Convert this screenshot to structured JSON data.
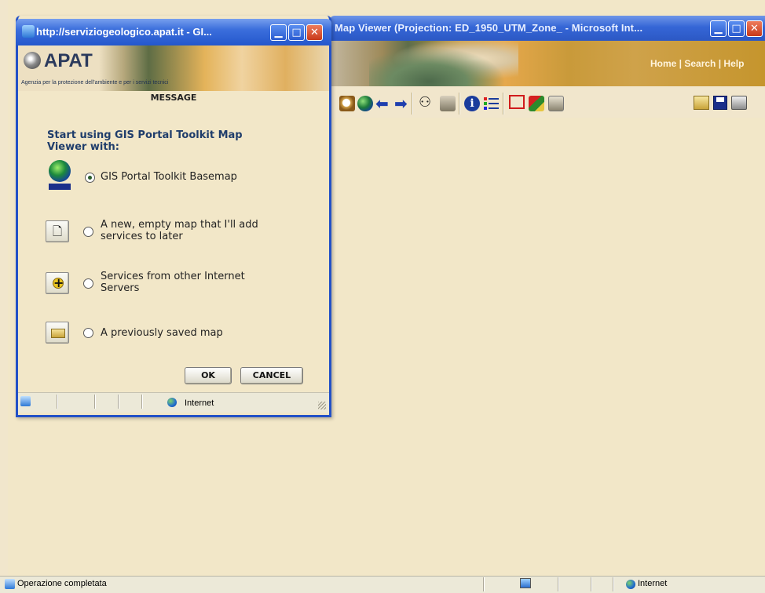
{
  "background_window": {
    "title": "Map Viewer (Projection: ED_1950_UTM_Zone_ - Microsoft Int...",
    "header_links": "Home | Search | Help",
    "toolbar_icons": [
      "zoom-extent-icon",
      "globe-icon",
      "arrow-left-icon",
      "arrow-right-icon",
      "binoculars-icon",
      "identify-features-icon",
      "info-icon",
      "legend-list-icon",
      "select-rectangle-icon",
      "select-by-graphic-icon",
      "clear-selection-icon",
      "open-folder-icon",
      "save-icon",
      "print-icon"
    ],
    "status_text": "Operazione completata",
    "zone_text": "Internet"
  },
  "popup": {
    "title": "http://serviziogeologico.apat.it - GI...",
    "logo_text": "APAT",
    "logo_subtitle": "Agenzia per la protezione dell'ambiente e per i servizi tecnici",
    "section_header": "MESSAGE",
    "intro": "Start using GIS Portal Toolkit Map Viewer with:",
    "options": [
      {
        "label": "GIS Portal Toolkit Basemap",
        "selected": true,
        "icon": "basemap-globe-icon"
      },
      {
        "label_line1": "A new, empty map that I'll add",
        "label_line2": "services to later",
        "selected": false,
        "icon": "new-document-icon"
      },
      {
        "label_line1": "Services from other Internet",
        "label_line2": "Servers",
        "selected": false,
        "icon": "add-service-icon"
      },
      {
        "label": "A previously saved map",
        "selected": false,
        "icon": "open-folder-icon"
      }
    ],
    "ok_label": "OK",
    "cancel_label": "CANCEL",
    "zone_text": "Internet"
  },
  "colors": {
    "page_background": "#f2e7c8",
    "titlebar_blue": "#2457cc",
    "intro_text": "#1f3d6b"
  }
}
